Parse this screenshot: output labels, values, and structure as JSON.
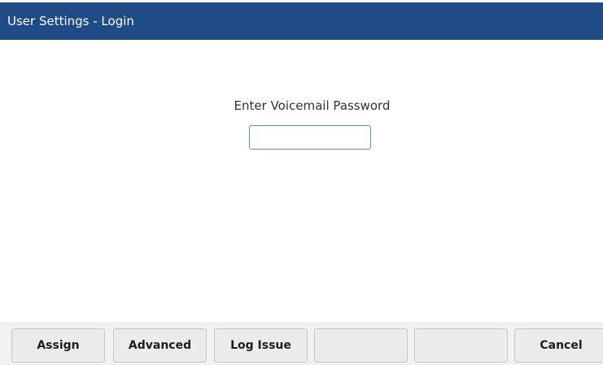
{
  "header": {
    "title": "User Settings - Login"
  },
  "main": {
    "prompt": "Enter Voicemail Password",
    "password_value": ""
  },
  "softkeys": [
    {
      "label": "Assign"
    },
    {
      "label": "Advanced"
    },
    {
      "label": "Log Issue"
    },
    {
      "label": ""
    },
    {
      "label": ""
    },
    {
      "label": "Cancel"
    }
  ],
  "colors": {
    "title_bar": "#1f4b87",
    "input_border": "#5a8fc7",
    "softkey_bg": "#ececec"
  }
}
